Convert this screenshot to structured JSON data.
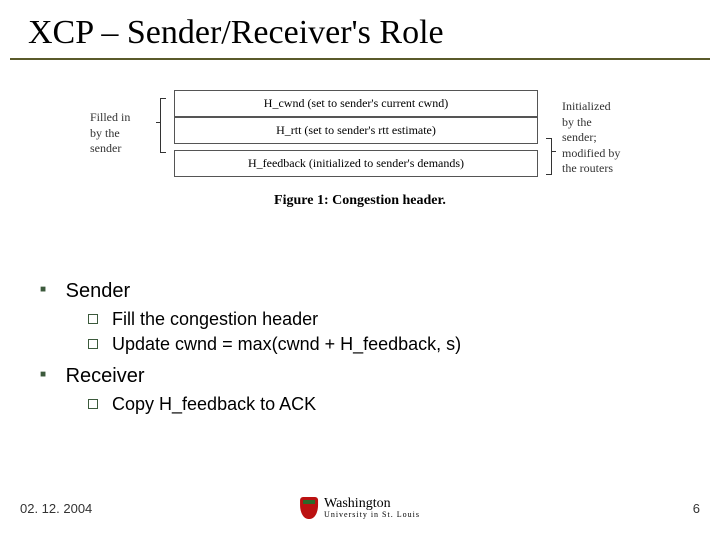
{
  "title": "XCP – Sender/Receiver's Role",
  "figure": {
    "left_label_l1": "Filled in",
    "left_label_l2": "by the",
    "left_label_l3": "sender",
    "cells": {
      "h_cwnd": "H_cwnd (set to sender's current cwnd)",
      "h_rtt": "H_rtt (set to sender's rtt estimate)",
      "h_feedback": "H_feedback (initialized to sender's demands)"
    },
    "right_label_l1": "Initialized",
    "right_label_l2": "by the",
    "right_label_l3": "sender;",
    "right_label_l4": "modified by",
    "right_label_l5": "the routers",
    "caption": "Figure 1: Congestion header."
  },
  "body": {
    "sender_heading": "Sender",
    "sender_items": {
      "a": "Fill the congestion header",
      "b": "Update cwnd = max(cwnd + H_feedback, s)"
    },
    "receiver_heading": "Receiver",
    "receiver_items": {
      "a": "Copy H_feedback to ACK"
    }
  },
  "footer": {
    "date": "02. 12. 2004",
    "page": "6",
    "university_line1": "Washington",
    "university_line2": "University in St. Louis"
  }
}
